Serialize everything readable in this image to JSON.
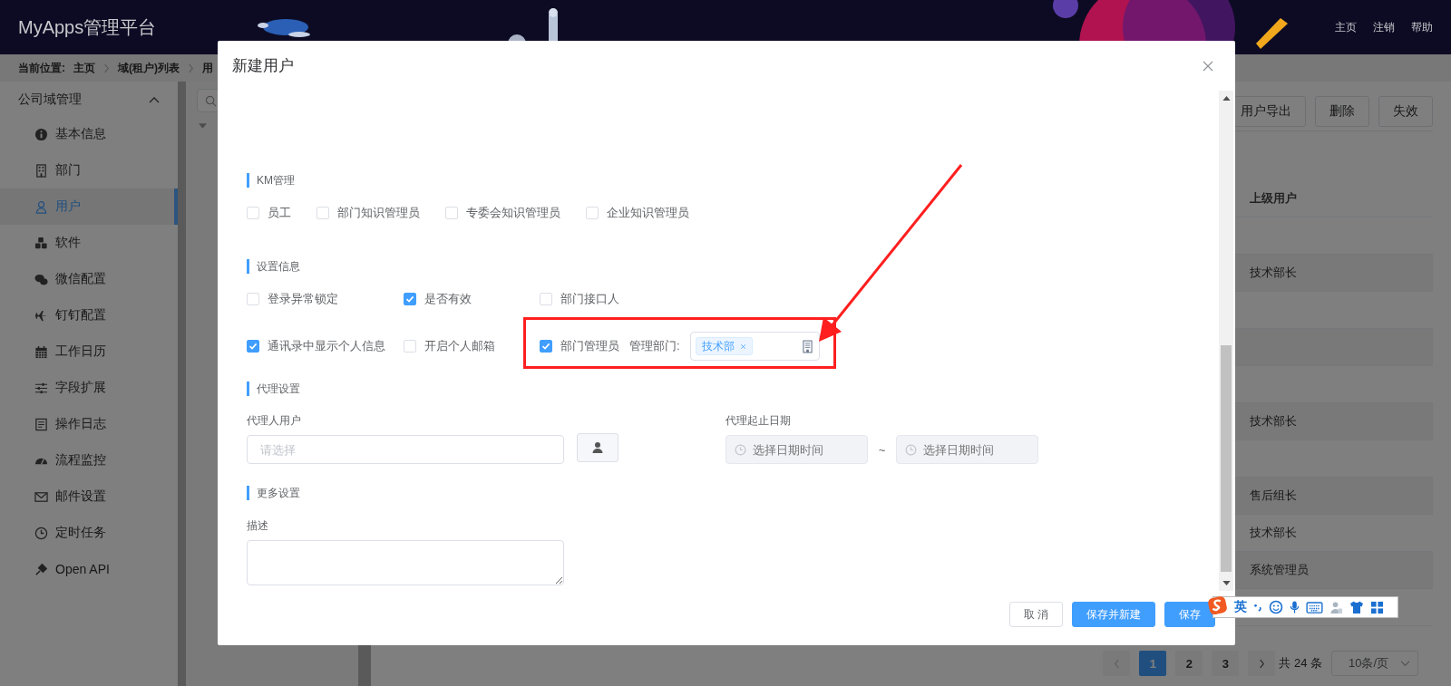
{
  "header": {
    "title": "MyApps管理平台",
    "nav_links": [
      "主页",
      "注销",
      "帮助"
    ]
  },
  "breadcrumb": {
    "label": "当前位置:",
    "items": [
      "主页",
      "域(租户)列表",
      "用"
    ]
  },
  "sidebar": {
    "group": "公司域管理",
    "expanded": true,
    "items": [
      {
        "label": "基本信息",
        "selected": false
      },
      {
        "label": "部门",
        "selected": false
      },
      {
        "label": "用户",
        "selected": true
      },
      {
        "label": "软件",
        "selected": false
      },
      {
        "label": "微信配置",
        "selected": false
      },
      {
        "label": "钉钉配置",
        "selected": false
      },
      {
        "label": "工作日历",
        "selected": false
      },
      {
        "label": "字段扩展",
        "selected": false
      },
      {
        "label": "操作日志",
        "selected": false
      },
      {
        "label": "流程监控",
        "selected": false
      },
      {
        "label": "邮件设置",
        "selected": false
      },
      {
        "label": "定时任务",
        "selected": false
      },
      {
        "label": "Open API",
        "selected": false
      }
    ]
  },
  "toolbar_buttons": [
    "用户导出",
    "删除",
    "失效"
  ],
  "table": {
    "columns": [
      "上级用户"
    ],
    "rows": [
      {},
      {
        "superior_user": "技术部长"
      },
      {},
      {},
      {},
      {
        "superior_user": "技术部长"
      },
      {},
      {
        "superior_user": "售后组长"
      },
      {
        "superior_user": "技术部长"
      },
      {
        "superior_user": "系统管理员"
      },
      {}
    ]
  },
  "pagination": {
    "pages": [
      {
        "label": "1",
        "selected": true
      },
      {
        "label": "2",
        "selected": false
      },
      {
        "label": "3",
        "selected": false
      }
    ],
    "total": "共 24 条",
    "page_size": "10条/页"
  },
  "dialog": {
    "title": "新建用户",
    "km": {
      "heading": "KM管理",
      "options": [
        {
          "label": "员工",
          "checked": false
        },
        {
          "label": "部门知识管理员",
          "checked": false
        },
        {
          "label": "专委会知识管理员",
          "checked": false
        },
        {
          "label": "企业知识管理员",
          "checked": false
        }
      ]
    },
    "settings": {
      "heading": "设置信息",
      "rows": [
        [
          {
            "kind": "checkbox",
            "label": "登录异常锁定",
            "checked": false
          },
          {
            "kind": "checkbox",
            "label": "是否有效",
            "checked": true
          },
          {
            "kind": "checkbox",
            "label": "部门接口人",
            "checked": false
          }
        ],
        [
          {
            "kind": "checkbox",
            "label": "通讯录中显示个人信息",
            "checked": true
          },
          {
            "kind": "checkbox",
            "label": "开启个人邮箱",
            "checked": false
          },
          {
            "kind": "checkbox",
            "label": "部门管理员",
            "checked": true
          },
          {
            "kind": "tag_select",
            "label": "管理部门:",
            "tags": [
              "技术部"
            ]
          }
        ]
      ]
    },
    "agent": {
      "heading": "代理设置",
      "user_label": "代理人用户",
      "user_placeholder": "请选择",
      "period_label": "代理起止日期",
      "start_placeholder": "选择日期时间",
      "separator": "~",
      "end_placeholder": "选择日期时间",
      "dates_disabled": true
    },
    "more": {
      "heading": "更多设置",
      "description_label": "描述"
    },
    "buttons": [
      {
        "label": "取 消",
        "kind": "default"
      },
      {
        "label": "保存并新建",
        "kind": "primary"
      },
      {
        "label": "保存",
        "kind": "primary"
      }
    ]
  },
  "ime_toolbar": {
    "mode": "英"
  }
}
